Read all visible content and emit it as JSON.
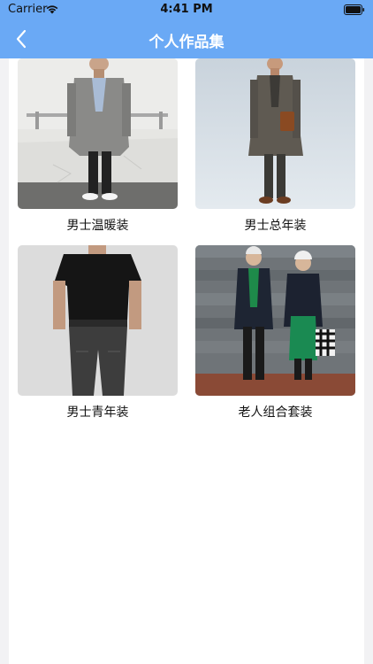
{
  "status": {
    "carrier": "Carrier",
    "time": "4:41 PM"
  },
  "nav": {
    "title": "个人作品集",
    "back_icon": "chevron-left-icon"
  },
  "colors": {
    "header": "#6aa9f5",
    "background": "#f2f2f4",
    "content": "#ffffff"
  },
  "gallery": {
    "items": [
      {
        "caption": "男士温暖装"
      },
      {
        "caption": "男士总年装"
      },
      {
        "caption": "男士青年装"
      },
      {
        "caption": "老人组合套装"
      }
    ]
  }
}
